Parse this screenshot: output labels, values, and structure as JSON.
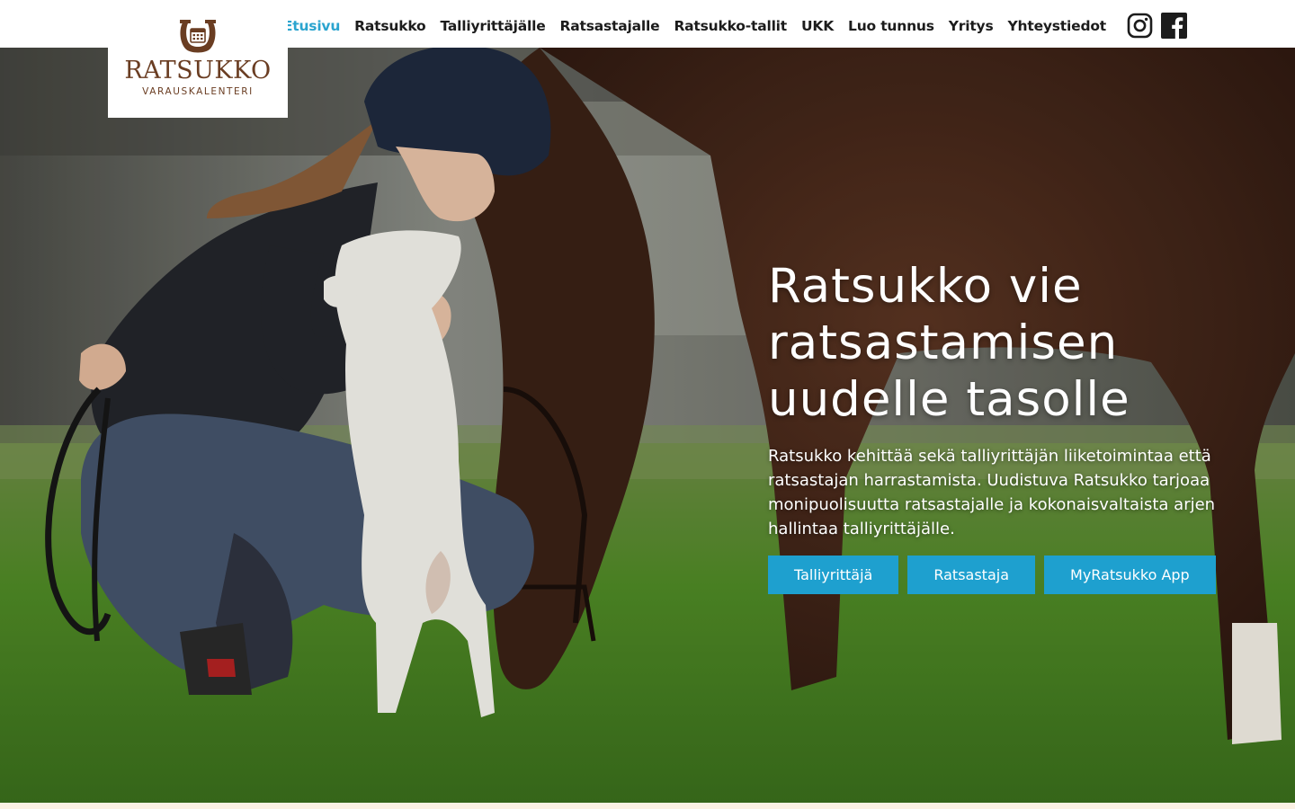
{
  "brand": {
    "name": "RATSUKKO",
    "tagline": "VARAUSKALENTERI",
    "color": "#6a3d22"
  },
  "nav": {
    "items": [
      {
        "label": "Etusivu",
        "active": true
      },
      {
        "label": "Ratsukko",
        "active": false
      },
      {
        "label": "Talliyrittäjälle",
        "active": false
      },
      {
        "label": "Ratsastajalle",
        "active": false
      },
      {
        "label": "Ratsukko-tallit",
        "active": false
      },
      {
        "label": "UKK",
        "active": false
      },
      {
        "label": "Luo tunnus",
        "active": false
      },
      {
        "label": "Yritys",
        "active": false
      },
      {
        "label": "Yhteystiedot",
        "active": false
      }
    ],
    "active_color": "#2aa4cf",
    "social": [
      "instagram-icon",
      "facebook-icon"
    ]
  },
  "hero": {
    "title_lines": [
      "Ratsukko vie",
      "ratsastamisen",
      "uudelle tasolle"
    ],
    "body": "Ratsukko kehittää sekä talliyrittäjän liiketoimintaa että ratsastajan harrastamista. Uudistuva Ratsukko tarjoaa monipuolisuutta ratsastajalle ja kokonaisvaltaista arjen hallintaa talliyrittäjälle.",
    "buttons": [
      "Talliyrittäjä",
      "Ratsastaja",
      "MyRatsukko App"
    ],
    "button_color": "#1ea0cf"
  }
}
